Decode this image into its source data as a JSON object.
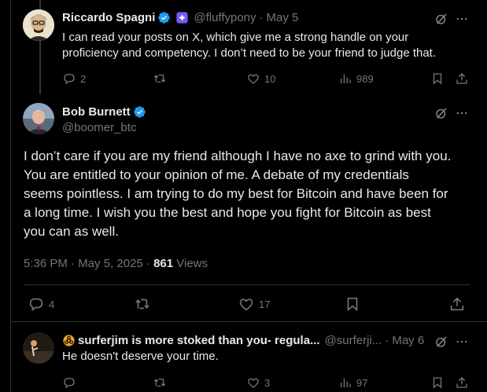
{
  "reply1": {
    "name": "Riccardo Spagni",
    "handle": "@fluffypony",
    "date": "May 5",
    "text_line1": "I can read your posts on X, which give me a strong handle on your",
    "text_line2": "proficiency and competency. I don’t need to be your friend to judge that.",
    "replies": "2",
    "likes": "10",
    "views": "989"
  },
  "main": {
    "name": "Bob Burnett",
    "handle": "@boomer_btc",
    "lines": [
      "I don’t care if you are my friend although I have no axe to grind with you.",
      "You are entitled to your opinion of me.  A debate of my credentials",
      "seems pointless.  I am trying to do my best for Bitcoin and have been for",
      "a long time.  I wish you the best and hope you fight for Bitcoin as best",
      "you can as well."
    ],
    "time": "5:36 PM · May 5, 2025 · ",
    "views_count": "861",
    "views_label": " Views",
    "replies": "4",
    "likes": "17"
  },
  "reply2": {
    "name": "surferjim is more stoked than you- regula...",
    "handle": "@surferji...",
    "date": "May 6",
    "text": "He doesn't deserve your time.",
    "likes": "3",
    "views": "97"
  },
  "colors": {
    "verified": "#1d9bf0",
    "background": "#000000",
    "muted": "#71767b",
    "badge": "#7856ff"
  }
}
